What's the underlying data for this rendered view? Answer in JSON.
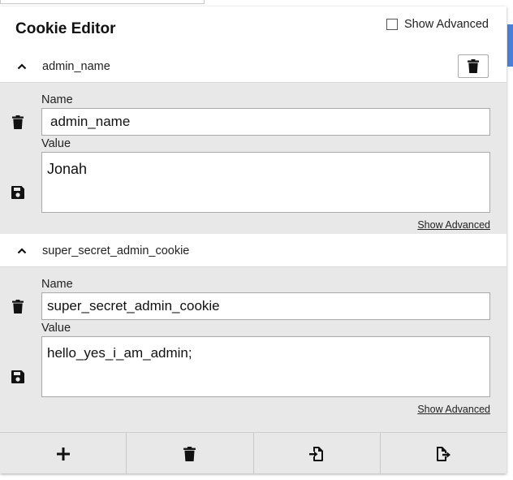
{
  "header": {
    "title": "Cookie Editor",
    "show_advanced_label": "Show Advanced"
  },
  "cookies": [
    {
      "title": "admin_name",
      "name_label": "Name",
      "name_value": "admin_name",
      "value_label": "Value",
      "value_value": "Jonah",
      "show_advanced": "Show Advanced"
    },
    {
      "title": "super_secret_admin_cookie",
      "name_label": "Name",
      "name_value": "super_secret_admin_cookie",
      "value_label": "Value",
      "value_value": "hello_yes_i_am_admin;",
      "show_advanced": "Show Advanced"
    }
  ],
  "footer": {
    "icons": [
      "plus-icon",
      "trash-icon",
      "import-icon",
      "export-icon"
    ]
  },
  "colors": {
    "panel_bg": "#e8e8e8",
    "accent_scroll": "#4a7fd6"
  }
}
